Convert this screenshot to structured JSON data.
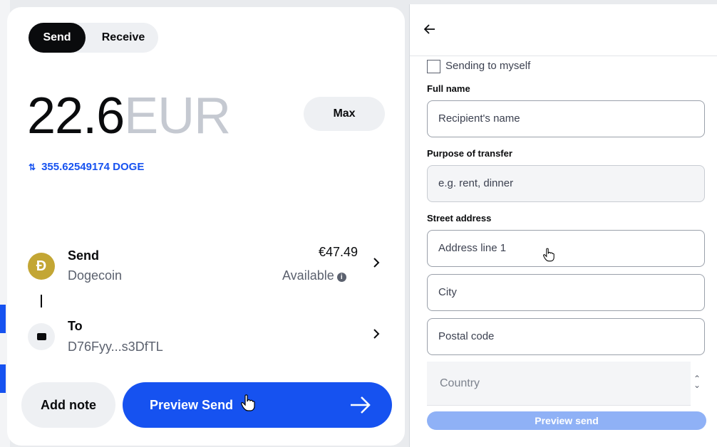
{
  "send_panel": {
    "tabs": {
      "send": "Send",
      "receive": "Receive"
    },
    "amount": {
      "value": "22.6",
      "currency": "EUR"
    },
    "max_label": "Max",
    "conversion": "355.62549174 DOGE",
    "asset_row": {
      "title": "Send",
      "subtitle": "Dogecoin",
      "value": "€47.49",
      "available": "Available",
      "coin_glyph": "Ð"
    },
    "to_row": {
      "title": "To",
      "subtitle": "D76Fyy...s3DfTL"
    },
    "add_note_label": "Add note",
    "preview_label": "Preview Send",
    "colors": {
      "primary": "#1652f0",
      "doge": "#c3a634"
    }
  },
  "recipient_panel": {
    "sending_to_myself": "Sending to myself",
    "full_name_label": "Full name",
    "full_name_placeholder": "Recipient's name",
    "purpose_label": "Purpose of transfer",
    "purpose_placeholder": "e.g. rent, dinner",
    "street_label": "Street address",
    "address_placeholder": "Address line 1",
    "city_placeholder": "City",
    "postal_placeholder": "Postal code",
    "country_placeholder": "Country",
    "preview_label": "Preview send"
  },
  "icons": [
    "back-arrow-icon",
    "swap-icon",
    "chevron-right-icon",
    "info-icon",
    "wallet-icon",
    "arrow-right-icon",
    "hand-cursor-icon",
    "sort-icon"
  ]
}
